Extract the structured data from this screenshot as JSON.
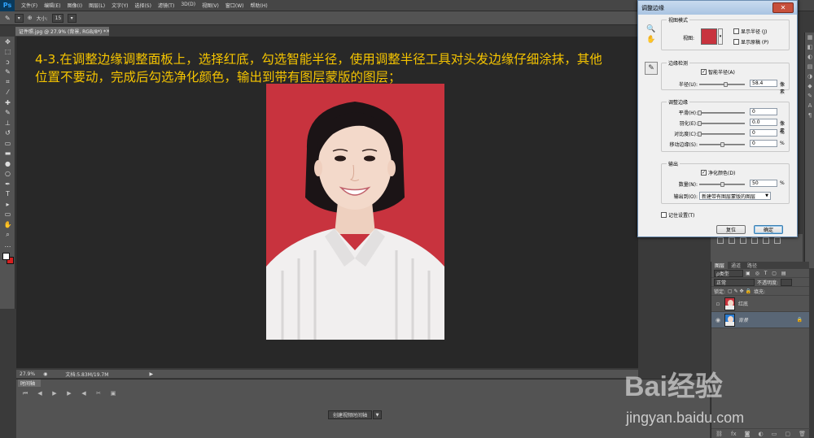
{
  "app": {
    "logo": "Ps"
  },
  "menu": [
    "文件(F)",
    "编辑(E)",
    "图像(I)",
    "图层(L)",
    "文字(Y)",
    "选择(S)",
    "滤镜(T)",
    "3D(D)",
    "视图(V)",
    "窗口(W)",
    "帮助(H)"
  ],
  "options_bar": {
    "size_label": "大小:",
    "size_value": "15"
  },
  "document": {
    "tab_title": "证件照.jpg @ 27.9% (背景, RGB/8*) *",
    "zoom": "27.9%",
    "doc_info": "文档:5.83M/19.7M"
  },
  "overlay_text": "4-3.在调整边缘调整面板上，选择红底，勾选智能半径，使用调整半径工具对头发边缘仔细涂抹，其他位置不要动，完成后勾选净化颜色，输出到带有图层蒙版的图层；",
  "timeline": {
    "tab": "时间轴",
    "create_button": "创建视频时间轴"
  },
  "layers": {
    "tabs": [
      "图层",
      "通道",
      "路径"
    ],
    "filter_label": "ρ类型",
    "blend_mode": "正常",
    "opacity_label": "不透明度:",
    "lock_label": "锁定:",
    "fill_label": "填充:",
    "items": [
      {
        "name": "红底",
        "selected": false
      },
      {
        "name": "背景",
        "selected": true
      }
    ]
  },
  "dialog": {
    "title": "调整边缘",
    "close": "✕",
    "view_mode": {
      "group": "视图模式",
      "view_label": "视图:",
      "show_radius": "显示半径 (J)",
      "show_original": "显示原稿 (P)"
    },
    "edge_detection": {
      "group": "边缘检测",
      "smart_radius": "智能半径(A)",
      "smart_radius_checked": true,
      "radius_label": "半径(U):",
      "radius_value": "58.4",
      "radius_unit": "像素",
      "radius_fraction": 0.58
    },
    "adjust_edge": {
      "group": "调整边缘",
      "smooth_label": "平滑(H):",
      "smooth_value": "0",
      "feather_label": "羽化(E):",
      "feather_value": "0.0",
      "feather_unit": "像素",
      "contrast_label": "对比度(C):",
      "contrast_value": "0",
      "contrast_unit": "%",
      "shift_label": "移动边缘(S):",
      "shift_value": "0",
      "shift_unit": "%"
    },
    "output": {
      "group": "输出",
      "decontaminate": "净化颜色(D)",
      "decontaminate_checked": true,
      "amount_label": "数量(N):",
      "amount_value": "50",
      "amount_unit": "%",
      "output_to_label": "输出到(O):",
      "output_to_value": "新建带有图层蒙版的图层"
    },
    "remember": "记住设置(T)",
    "reset_button": "复位",
    "ok_button": "确定"
  },
  "watermark": {
    "logo": "Bai经验",
    "url": "jingyan.baidu.com"
  }
}
